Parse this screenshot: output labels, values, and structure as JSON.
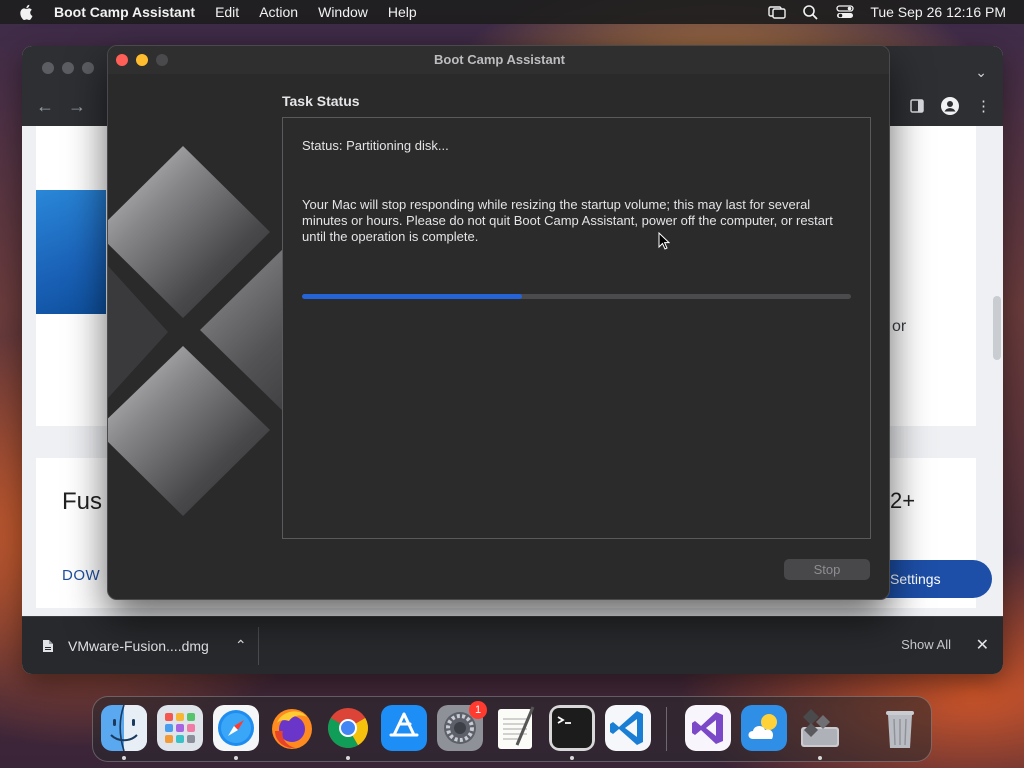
{
  "menubar": {
    "app_name": "Boot Camp Assistant",
    "menus": [
      "Edit",
      "Action",
      "Window",
      "Help"
    ],
    "clock": "Tue Sep 26  12:16 PM"
  },
  "browser": {
    "fusion_heading": "Fus",
    "download_link": "DOW",
    "version_text": "2+",
    "side_text_1": "or",
    "settings_button": "Settings",
    "download_file": "VMware-Fusion....dmg",
    "show_all": "Show All"
  },
  "bootcamp": {
    "window_title": "Boot Camp Assistant",
    "task_title": "Task Status",
    "status": "Status: Partitioning disk...",
    "message": "Your Mac will stop responding while resizing the startup volume; this may last for several minutes or hours. Please do not quit Boot Camp Assistant, power off the computer, or restart until the operation is complete.",
    "progress_percent": 40,
    "stop_label": "Stop"
  },
  "dock": {
    "items": [
      "finder-icon",
      "launchpad-icon",
      "safari-icon",
      "firefox-icon",
      "chrome-icon",
      "app-store-icon",
      "system-preferences-icon",
      "textedit-icon",
      "terminal-icon",
      "vscode-icon",
      "visual-studio-icon",
      "weather-icon",
      "boot-camp-icon",
      "trash-icon"
    ],
    "system_preferences_badge": "1"
  }
}
